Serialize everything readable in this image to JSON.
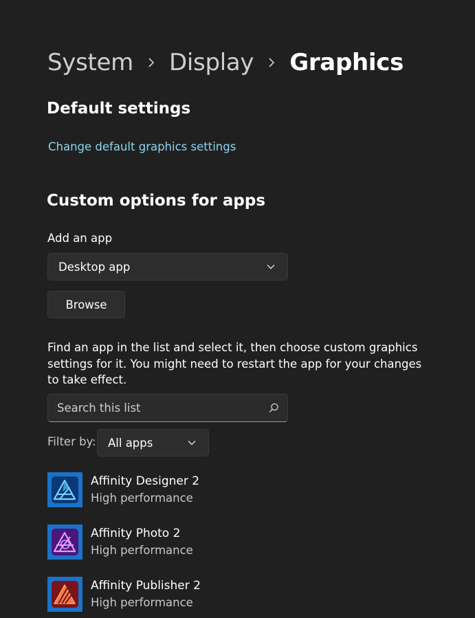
{
  "breadcrumb": {
    "items": [
      "System",
      "Display",
      "Graphics"
    ]
  },
  "default_settings": {
    "title": "Default settings",
    "link_text": "Change default graphics settings"
  },
  "custom_options": {
    "title": "Custom options for apps",
    "add_app_label": "Add an app",
    "app_type_selected": "Desktop app",
    "browse_label": "Browse",
    "description": "Find an app in the list and select it, then choose custom graphics settings for it. You might need to restart the app for your changes to take effect.",
    "search_placeholder": "Search this list",
    "filter_label": "Filter by:",
    "filter_selected": "All apps"
  },
  "apps": [
    {
      "name": "Affinity Designer 2",
      "status": "High performance",
      "icon": "affinity-designer-icon",
      "color": "#1b72c9"
    },
    {
      "name": "Affinity Photo 2",
      "status": "High performance",
      "icon": "affinity-photo-icon",
      "color": "#7b2fb8"
    },
    {
      "name": "Affinity Publisher 2",
      "status": "High performance",
      "icon": "affinity-publisher-icon",
      "color": "#c0262b"
    }
  ],
  "colors": {
    "background": "#202020",
    "accent_link": "#8ad6f1",
    "control_bg": "#2d2d2d"
  }
}
